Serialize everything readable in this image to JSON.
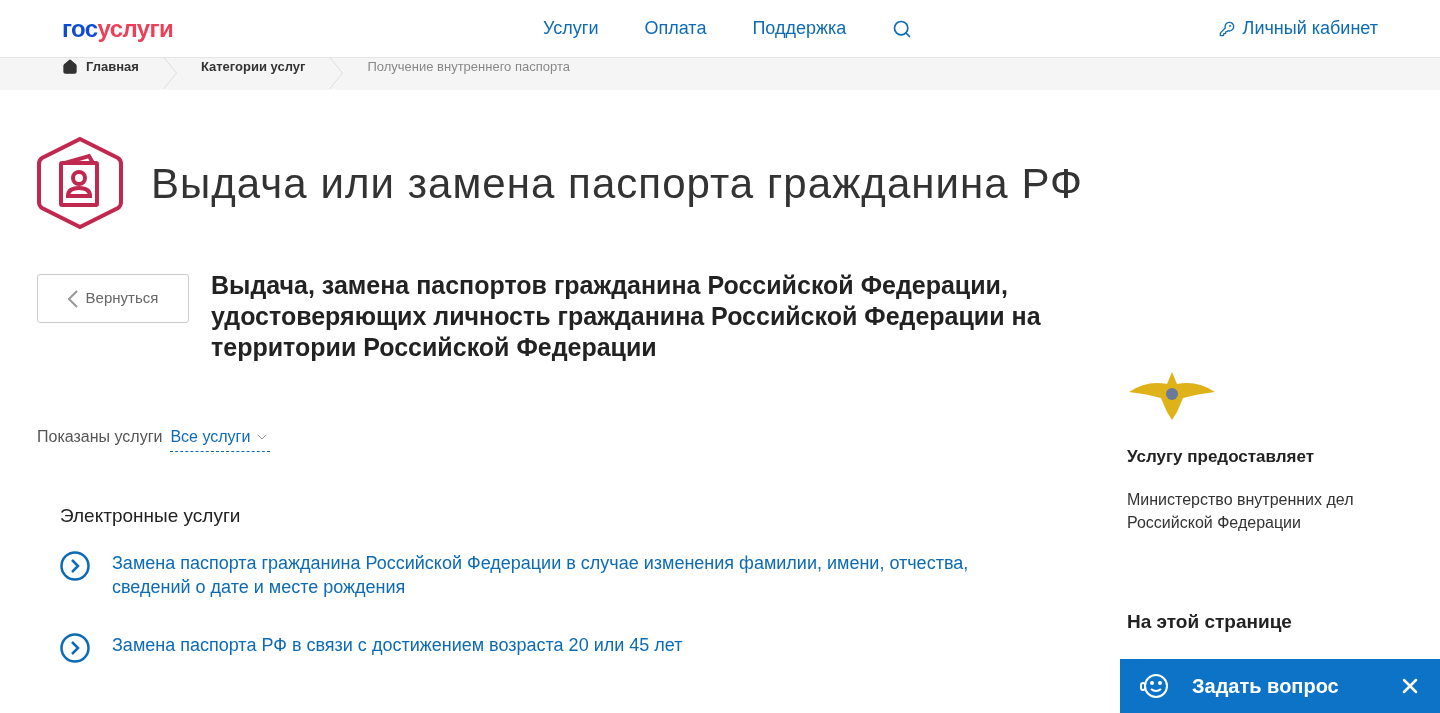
{
  "header": {
    "logo": {
      "first": "гос",
      "second": "услуги"
    },
    "nav": [
      "Услуги",
      "Оплата",
      "Поддержка"
    ],
    "account": "Личный кабинет"
  },
  "breadcrumbs": [
    {
      "label": "Главная",
      "kind": "home"
    },
    {
      "label": "Категории услуг",
      "kind": "link"
    },
    {
      "label": "Получение внутреннего паспорта",
      "kind": "current"
    }
  ],
  "page_title": "Выдача или замена паспорта гражданина РФ",
  "back_button": "Вернуться",
  "service_title": "Выдача, замена паспортов гражданина Российской Федерации, удостоверяющих личность гражданина Российской Федерации на территории Российской Федерации",
  "filter": {
    "label": "Показаны услуги",
    "value": "Все услуги"
  },
  "section_title": "Электронные услуги",
  "services": [
    "Замена паспорта гражданина Российской Федерации в случае изменения фамилии, имени, отчества, сведений о дате и месте рождения",
    "Замена паспорта РФ в связи с достижением возраста 20 или 45 лет"
  ],
  "sidebar": {
    "provider_heading": "Услугу предоставляет",
    "provider": "Министерство внутренних дел Российской Федерации",
    "on_page_heading": "На этой странице"
  },
  "chat_widget": {
    "label": "Задать вопрос"
  }
}
